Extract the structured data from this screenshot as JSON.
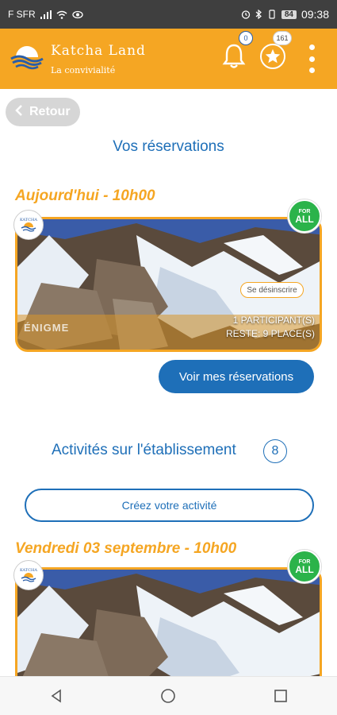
{
  "status_bar": {
    "carrier": "F SFR",
    "battery": "84",
    "time": "09:38"
  },
  "app_bar": {
    "brand_name": "Katcha Land",
    "brand_tagline": "La convivialité",
    "notification_count": "0",
    "points_count": "161",
    "accent_color": "#f5a623"
  },
  "back_button": {
    "label": "Retour"
  },
  "reservations": {
    "title": "Vos réservations",
    "date_label": "Aujourd'hui - 10h00",
    "card": {
      "logo_text": "KATCHA",
      "badge_top": "FOR",
      "badge_bottom": "ALL",
      "unsubscribe_label": "Se désinscrire",
      "activity_type": "ÉNIGME",
      "participants": "1 PARTICIPANT(S)",
      "remaining": "RESTE: 9 PLACE(S)"
    },
    "view_button_label": "Voir mes réservations"
  },
  "activities": {
    "title": "Activités sur l'établissement",
    "count": "8",
    "create_button_label": "Créez votre activité",
    "date_label": "Vendredi 03 septembre - 10h00",
    "card": {
      "logo_text": "KATCHA",
      "badge_top": "FOR",
      "badge_bottom": "ALL"
    }
  },
  "colors": {
    "primary_blue": "#1e6fb8",
    "orange": "#f5a623",
    "green_badge": "#2bb34a"
  }
}
